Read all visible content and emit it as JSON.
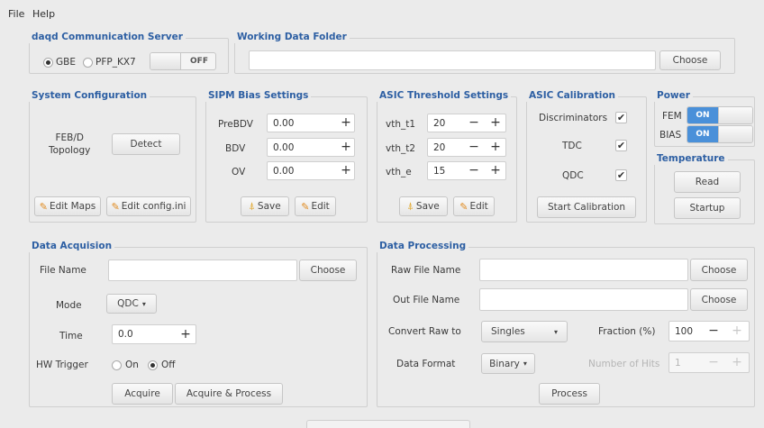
{
  "menu": {
    "file": "File",
    "help": "Help"
  },
  "daqd": {
    "title": "daqd Communication Server",
    "radio_gbe": "GBE",
    "radio_pfp": "PFP_KX7",
    "switch_label": "OFF"
  },
  "working_folder": {
    "title": "Working Data Folder",
    "value": "",
    "choose": "Choose"
  },
  "system_config": {
    "title": "System Configuration",
    "topology_label": "FEB/D\nTopology",
    "detect": "Detect",
    "edit_maps": "Edit Maps",
    "edit_config": "Edit config.ini"
  },
  "sipm": {
    "title": "SIPM Bias Settings",
    "rows": [
      {
        "label": "PreBDV",
        "value": "0.00"
      },
      {
        "label": "BDV",
        "value": "0.00"
      },
      {
        "label": "OV",
        "value": "0.00"
      }
    ],
    "save": "Save",
    "edit": "Edit"
  },
  "asic_threshold": {
    "title": "ASIC Threshold Settings",
    "rows": [
      {
        "label": "vth_t1",
        "value": "20"
      },
      {
        "label": "vth_t2",
        "value": "20"
      },
      {
        "label": "vth_e",
        "value": "15"
      }
    ],
    "save": "Save",
    "edit": "Edit"
  },
  "asic_calibration": {
    "title": "ASIC Calibration",
    "rows": [
      {
        "label": "Discriminators",
        "checked": "✔"
      },
      {
        "label": "TDC",
        "checked": "✔"
      },
      {
        "label": "QDC",
        "checked": "✔"
      }
    ],
    "start": "Start Calibration"
  },
  "power": {
    "title": "Power",
    "fem_label": "FEM",
    "fem_state": "ON",
    "bias_label": "BIAS",
    "bias_state": "ON"
  },
  "temperature": {
    "title": "Temperature",
    "read": "Read",
    "startup": "Startup"
  },
  "acquisition": {
    "title": "Data Acquision",
    "file_name_label": "File Name",
    "file_name_value": "",
    "choose": "Choose",
    "mode_label": "Mode",
    "mode_value": "QDC",
    "time_label": "Time",
    "time_value": "0.0",
    "hw_trigger_label": "HW Trigger",
    "on": "On",
    "off": "Off",
    "acquire": "Acquire",
    "acquire_process": "Acquire & Process"
  },
  "processing": {
    "title": "Data Processing",
    "raw_label": "Raw File Name",
    "raw_value": "",
    "out_label": "Out File Name",
    "out_value": "",
    "choose": "Choose",
    "convert_label": "Convert Raw to",
    "convert_value": "Singles",
    "fraction_label": "Fraction (%)",
    "fraction_value": "100",
    "format_label": "Data Format",
    "format_value": "Binary",
    "hits_label": "Number of Hits",
    "hits_value": "1",
    "process": "Process"
  },
  "icons": {
    "plus": "+",
    "minus": "−",
    "arrow": "▾",
    "edit": "✎",
    "save": "⍋"
  }
}
